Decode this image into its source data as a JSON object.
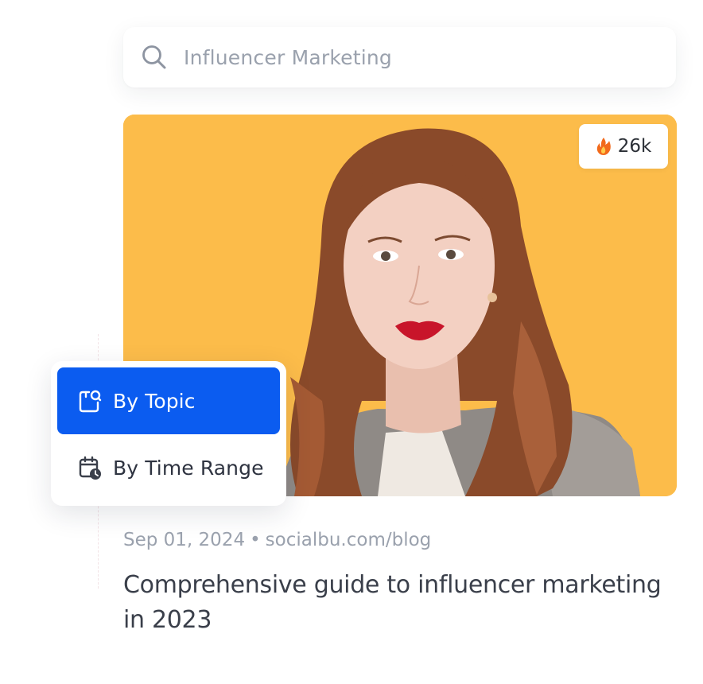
{
  "search": {
    "value": "Influencer Marketing",
    "icon": "search-icon"
  },
  "card": {
    "image_subject": "portrait-photo",
    "background_color": "#fcbc4a",
    "badge": {
      "icon": "fire-emoji",
      "count": "26k"
    },
    "date": "Sep 01, 2024",
    "separator": "•",
    "source": "socialbu.com/blog",
    "title": "Comprehensive guide to influencer marketing in 2023"
  },
  "filter_menu": {
    "items": [
      {
        "label": "By Topic",
        "icon": "topic-icon",
        "active": true
      },
      {
        "label": "By Time Range",
        "icon": "calendar-clock-icon",
        "active": false
      }
    ],
    "accent_color": "#0b5cf0"
  }
}
